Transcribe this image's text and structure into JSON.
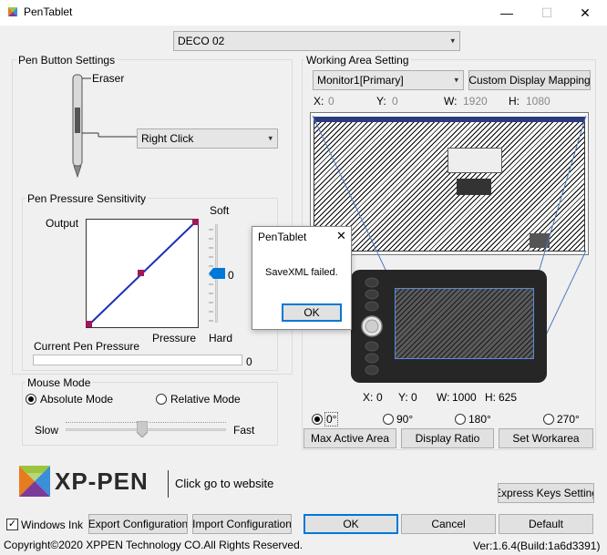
{
  "window": {
    "title": "PenTablet",
    "minimize": "—",
    "maximize": "☐",
    "close": "✕"
  },
  "device": {
    "selected": "DECO 02"
  },
  "pen_button": {
    "group_label": "Pen Button Settings",
    "eraser_label": "Eraser",
    "button_value": "Right Click"
  },
  "pressure": {
    "group_label": "Pen Pressure Sensitivity",
    "output_label": "Output",
    "pressure_label": "Pressure",
    "soft_label": "Soft",
    "hard_label": "Hard",
    "slider_value": "0",
    "slider_level": 0,
    "current_label": "Current Pen Pressure",
    "current_value": "0"
  },
  "mouse_mode": {
    "group_label": "Mouse Mode",
    "absolute": "Absolute Mode",
    "relative": "Relative Mode",
    "selected": "absolute",
    "slow": "Slow",
    "fast": "Fast"
  },
  "working_area": {
    "group_label": "Working Area Setting",
    "monitor": "Monitor1[Primary]",
    "custom_mapping": "Custom Display Mapping",
    "x_label": "X:",
    "x_value": "0",
    "y_label": "Y:",
    "y_value": "0",
    "w_label": "W:",
    "w_value": "1920",
    "h_label": "H:",
    "h_value": "1080",
    "tablet_x_label": "X:",
    "tablet_x_value": "0",
    "tablet_y_label": "Y:",
    "tablet_y_value": "0",
    "tablet_w_label": "W:",
    "tablet_w_value": "1000",
    "tablet_h_label": "H:",
    "tablet_h_value": "625",
    "rotations": [
      "0°",
      "90°",
      "180°",
      "270°"
    ],
    "rotation_selected": "0°",
    "max_active_area": "Max Active Area",
    "display_ratio": "Display Ratio",
    "set_workarea": "Set Workarea"
  },
  "dialog": {
    "title": "PenTablet",
    "message": "SaveXML failed.",
    "ok": "OK",
    "close": "✕"
  },
  "branding": {
    "logo_text": "XP-PEN",
    "website_link": "Click go to website"
  },
  "bottom": {
    "express_keys": "Express Keys Setting",
    "windows_ink": "Windows Ink",
    "windows_ink_checked": true,
    "export": "Export Configuration",
    "import": "Import Configuration",
    "ok": "OK",
    "cancel": "Cancel",
    "default": "Default",
    "copyright": "Copyright©2020  XPPEN Technology CO.All Rights Reserved.",
    "version": "Ver:1.6.4(Build:1a6d3391)"
  }
}
